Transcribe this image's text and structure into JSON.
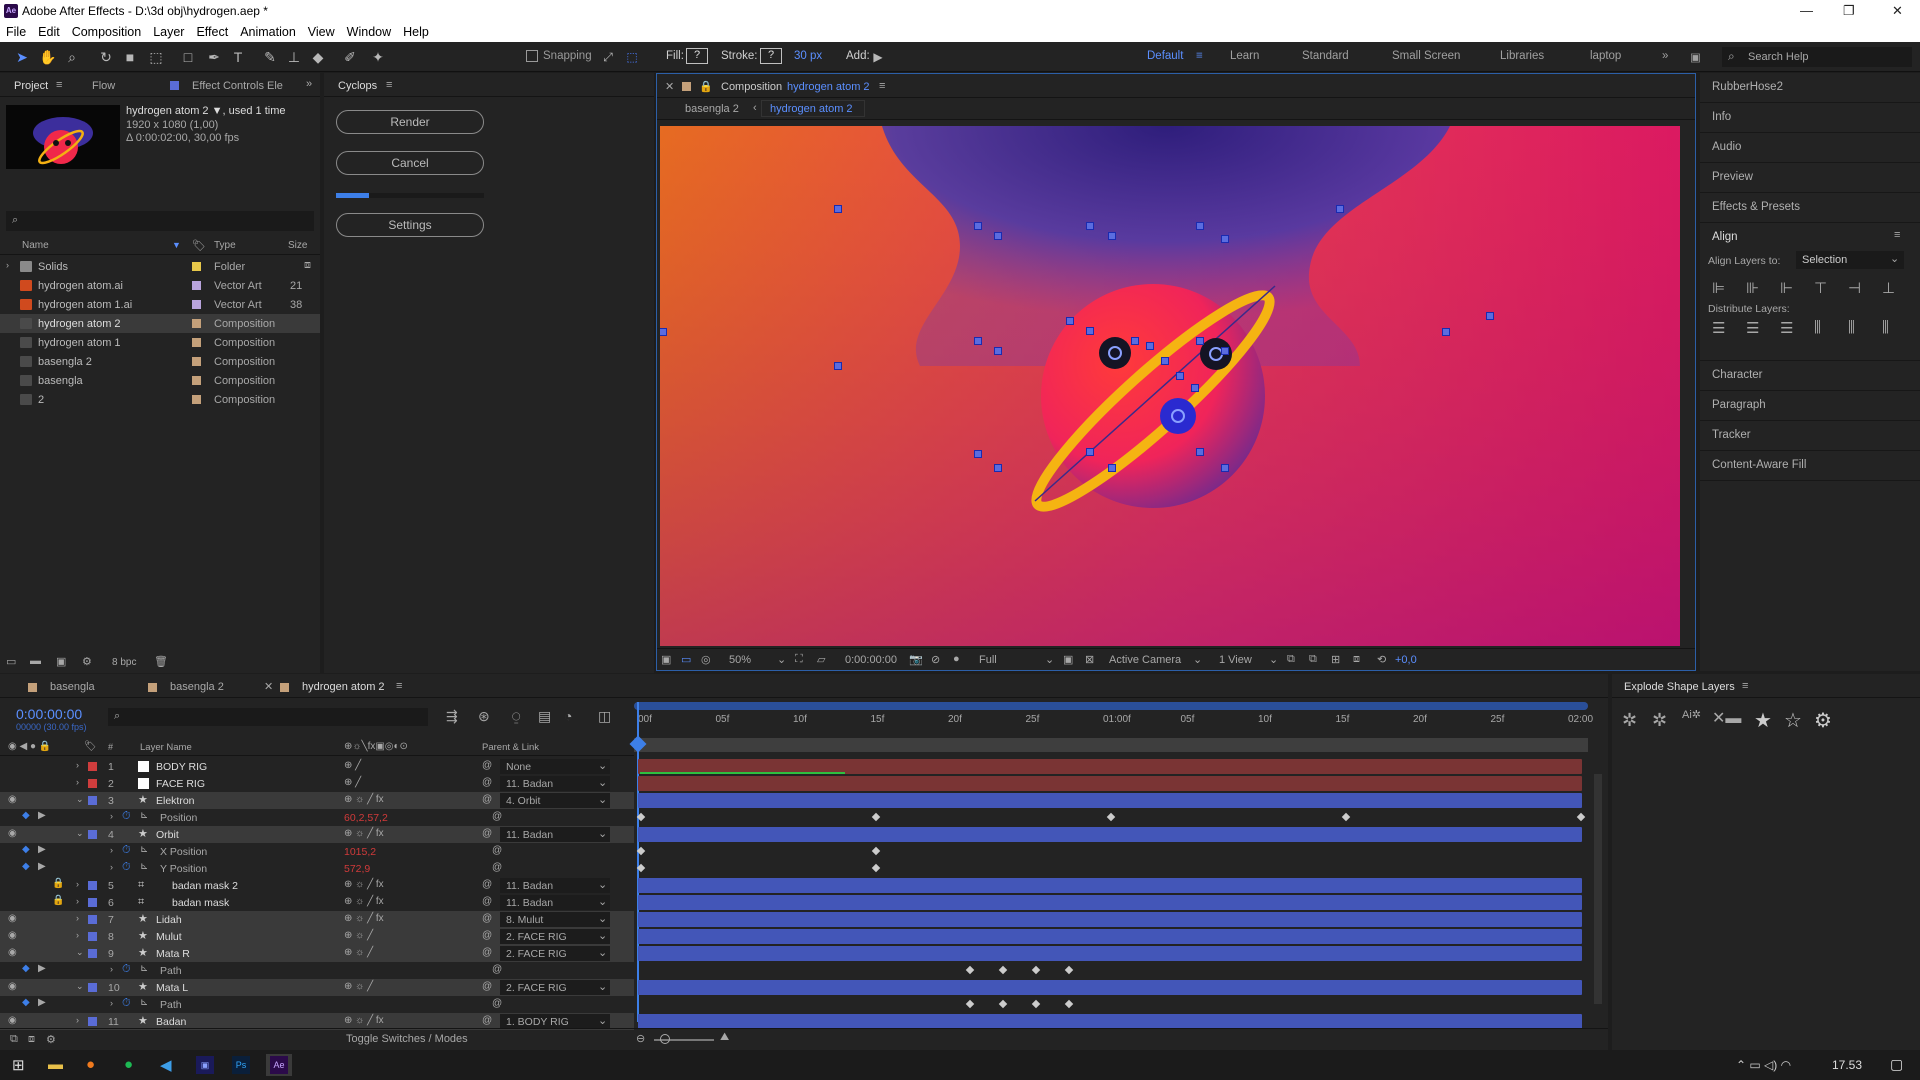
{
  "window": {
    "title": "Adobe After Effects - D:\\3d obj\\hydrogen.aep *",
    "logo": "Ae"
  },
  "menu": [
    "File",
    "Edit",
    "Composition",
    "Layer",
    "Effect",
    "Animation",
    "View",
    "Window",
    "Help"
  ],
  "toolbar": {
    "snapping": "Snapping",
    "fill_label": "Fill:",
    "fill_value": "?",
    "stroke_label": "Stroke:",
    "stroke_value": "?",
    "stroke_px": "30 px",
    "add_label": "Add:",
    "workspaces": [
      "Default",
      "Learn",
      "Standard",
      "Small Screen",
      "Libraries",
      "laptop"
    ],
    "search_help": "Search Help"
  },
  "project": {
    "tabs": [
      "Project",
      "Flow",
      "Effect Controls Ele"
    ],
    "preview_name": "hydrogen atom 2 ▼, used 1 time",
    "preview_dims": "1920 x 1080 (1,00)",
    "preview_dur": "Δ 0:00:02:00, 30,00 fps",
    "search_placeholder": "⌕",
    "columns": [
      "Name",
      "Type",
      "Size"
    ],
    "items": [
      {
        "name": "Solids",
        "type": "Folder",
        "size": "",
        "color": "#e8c84a"
      },
      {
        "name": "hydrogen atom.ai",
        "type": "Vector Art",
        "size": "21",
        "color": "#b9a4dc"
      },
      {
        "name": "hydrogen atom 1.ai",
        "type": "Vector Art",
        "size": "38",
        "color": "#b9a4dc"
      },
      {
        "name": "hydrogen atom 2",
        "type": "Composition",
        "size": "",
        "color": "#c4a07a"
      },
      {
        "name": "hydrogen atom 1",
        "type": "Composition",
        "size": "",
        "color": "#c4a07a"
      },
      {
        "name": "basengla 2",
        "type": "Composition",
        "size": "",
        "color": "#c4a07a"
      },
      {
        "name": "basengla",
        "type": "Composition",
        "size": "",
        "color": "#c4a07a"
      },
      {
        "name": "2",
        "type": "Composition",
        "size": "",
        "color": "#c4a07a"
      }
    ],
    "bpc": "8 bpc"
  },
  "cyclops": {
    "title": "Cyclops",
    "render": "Render",
    "cancel": "Cancel",
    "settings": "Settings",
    "progress": 0.22
  },
  "comp": {
    "title": "Composition",
    "name": "hydrogen atom 2",
    "crumbs": [
      "basengla 2",
      "hydrogen atom 2"
    ],
    "zoom": "50%",
    "time": "0:00:00:00",
    "resolution": "Full",
    "camera": "Active Camera",
    "view": "1 View",
    "exposure": "+0,0"
  },
  "right_panel": {
    "items": [
      "RubberHose2",
      "Info",
      "Audio",
      "Preview",
      "Effects & Presets",
      "Align",
      "Character",
      "Paragraph",
      "Tracker",
      "Content-Aware Fill"
    ],
    "align_to_label": "Align Layers to:",
    "align_to_value": "Selection",
    "distribute_label": "Distribute Layers:"
  },
  "timeline": {
    "tabs": [
      "basengla",
      "basengla 2",
      "hydrogen atom 2"
    ],
    "time": "0:00:00:00",
    "fps": "00000 (30.00 fps)",
    "ruler": [
      "00f",
      "05f",
      "10f",
      "15f",
      "20f",
      "25f",
      "01:00f",
      "05f",
      "10f",
      "15f",
      "20f",
      "25f",
      "02:00"
    ],
    "col_layer": "Layer Name",
    "col_parent": "Parent & Link",
    "toggle": "Toggle Switches / Modes",
    "layers": [
      {
        "num": "1",
        "name": "BODY RIG",
        "parent": "None",
        "color": "#cf3d3d",
        "kind": "layer",
        "bar": "red"
      },
      {
        "num": "2",
        "name": "FACE RIG",
        "parent": "11. Badan",
        "color": "#cf3d3d",
        "kind": "layer",
        "bar": "red"
      },
      {
        "num": "3",
        "name": "Elektron",
        "parent": "4. Orbit",
        "color": "#5a6cd6",
        "kind": "layer",
        "bar": "blue",
        "sel": true
      },
      {
        "num": "",
        "name": "Position",
        "value": "60,2,57,2",
        "kind": "prop"
      },
      {
        "num": "4",
        "name": "Orbit",
        "parent": "11. Badan",
        "color": "#5a6cd6",
        "kind": "layer",
        "bar": "blue",
        "sel": true
      },
      {
        "num": "",
        "name": "X Position",
        "value": "1015,2",
        "kind": "prop"
      },
      {
        "num": "",
        "name": "Y Position",
        "value": "572,9",
        "kind": "prop"
      },
      {
        "num": "5",
        "name": "badan mask 2",
        "parent": "11. Badan",
        "color": "#5a6cd6",
        "kind": "layer",
        "bar": "blue"
      },
      {
        "num": "6",
        "name": "badan mask",
        "parent": "11. Badan",
        "color": "#5a6cd6",
        "kind": "layer",
        "bar": "blue"
      },
      {
        "num": "7",
        "name": "Lidah",
        "parent": "8. Mulut",
        "color": "#5a6cd6",
        "kind": "layer",
        "bar": "blue",
        "sel": true
      },
      {
        "num": "8",
        "name": "Mulut",
        "parent": "2. FACE RIG",
        "color": "#5a6cd6",
        "kind": "layer",
        "bar": "blue",
        "sel": true
      },
      {
        "num": "9",
        "name": "Mata R",
        "parent": "2. FACE RIG",
        "color": "#5a6cd6",
        "kind": "layer",
        "bar": "blue",
        "sel": true
      },
      {
        "num": "",
        "name": "Path",
        "value": "",
        "kind": "prop"
      },
      {
        "num": "10",
        "name": "Mata L",
        "parent": "2. FACE RIG",
        "color": "#5a6cd6",
        "kind": "layer",
        "bar": "blue",
        "sel": true
      },
      {
        "num": "",
        "name": "Path",
        "value": "",
        "kind": "prop"
      },
      {
        "num": "11",
        "name": "Badan",
        "parent": "1. BODY RIG",
        "color": "#5a6cd6",
        "kind": "layer",
        "bar": "blue",
        "sel": true
      }
    ]
  },
  "explode": {
    "title": "Explode Shape Layers"
  },
  "taskbar": {
    "time": "17.53"
  }
}
